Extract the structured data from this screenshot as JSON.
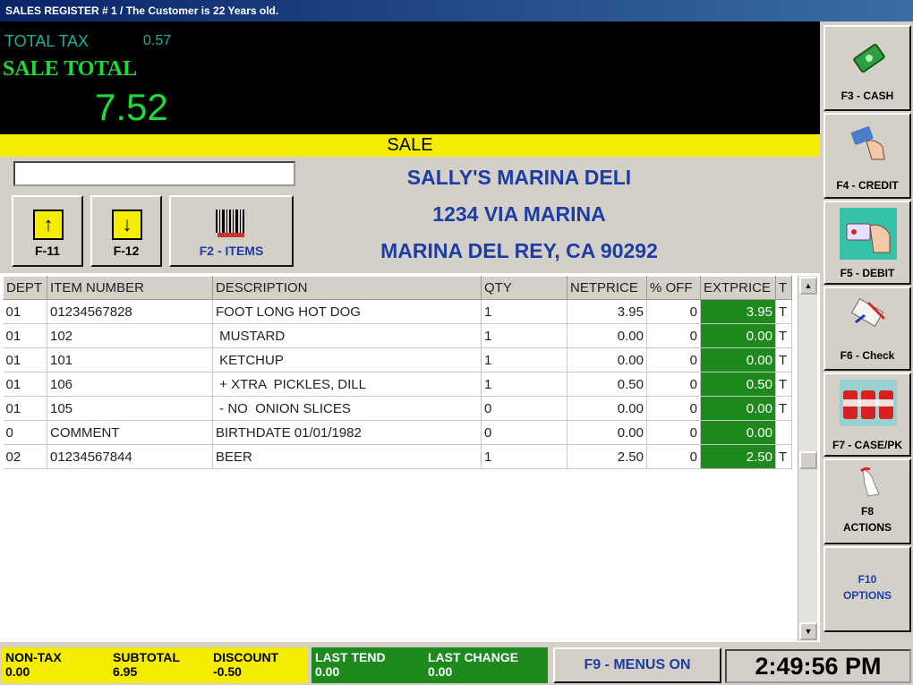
{
  "window": {
    "title": "SALES REGISTER # 1  / The Customer is 22 Years old."
  },
  "totals": {
    "tax_label": "TOTAL TAX",
    "tax_value": "0.57",
    "sale_total_label": "SALE TOTAL",
    "sale_total_value": "7.52"
  },
  "mode_label": "SALE",
  "entry": {
    "value": ""
  },
  "buttons": {
    "up_label": "F-11",
    "down_label": "F-12",
    "items_label": "F2 - ITEMS"
  },
  "store": {
    "name": "SALLY'S MARINA DELI",
    "address": "1234 VIA MARINA",
    "city": "MARINA DEL REY, CA 90292"
  },
  "table": {
    "headers": [
      "DEPT",
      "ITEM NUMBER",
      "DESCRIPTION",
      "QTY",
      "NETPRICE",
      "% OFF",
      "EXTPRICE",
      "T"
    ],
    "rows": [
      [
        "01",
        "01234567828",
        "FOOT LONG HOT DOG",
        "1",
        "3.95",
        "0",
        "3.95",
        "T"
      ],
      [
        "01",
        "102",
        " MUSTARD",
        "1",
        "0.00",
        "0",
        "0.00",
        "T"
      ],
      [
        "01",
        "101",
        " KETCHUP",
        "1",
        "0.00",
        "0",
        "0.00",
        "T"
      ],
      [
        "01",
        "106",
        " + XTRA  PICKLES, DILL",
        "1",
        "0.50",
        "0",
        "0.50",
        "T"
      ],
      [
        "01",
        "105",
        " - NO  ONION SLICES",
        "0",
        "0.00",
        "0",
        "0.00",
        "T"
      ],
      [
        "0",
        "COMMENT",
        "BIRTHDATE 01/01/1982",
        "0",
        "0.00",
        "0",
        "0.00",
        ""
      ],
      [
        "02",
        "01234567844",
        "BEER",
        "1",
        "2.50",
        "0",
        "2.50",
        "T"
      ]
    ]
  },
  "side_buttons": [
    {
      "label": "F3 - CASH",
      "icon": "cash-icon"
    },
    {
      "label": "F4 - CREDIT",
      "icon": "credit-card-icon"
    },
    {
      "label": "F5 - DEBIT",
      "icon": "debit-card-icon"
    },
    {
      "label": "F6 - Check",
      "icon": "check-icon"
    },
    {
      "label": "F7 - CASE/PK",
      "icon": "case-pack-icon"
    },
    {
      "label_line1": "F8",
      "label_line2": "ACTIONS",
      "icon": "actions-icon"
    },
    {
      "label_line1": "F10",
      "label_line2": "OPTIONS"
    }
  ],
  "bottom": {
    "non_tax_label": "NON-TAX",
    "non_tax_value": "0.00",
    "subtotal_label": "SUBTOTAL",
    "subtotal_value": "6.95",
    "discount_label": "DISCOUNT",
    "discount_value": "-0.50",
    "last_tend_label": "LAST TEND",
    "last_tend_value": "0.00",
    "last_change_label": "LAST CHANGE",
    "last_change_value": "0.00",
    "menus_label": "F9 - MENUS ON",
    "clock": "2:49:56 PM"
  },
  "colors": {
    "yellow": "#f5ed00",
    "green": "#1e8a1e",
    "blue_text": "#1c3da8",
    "tax_text": "#14b3a0",
    "total_text": "#1ddc3a"
  }
}
